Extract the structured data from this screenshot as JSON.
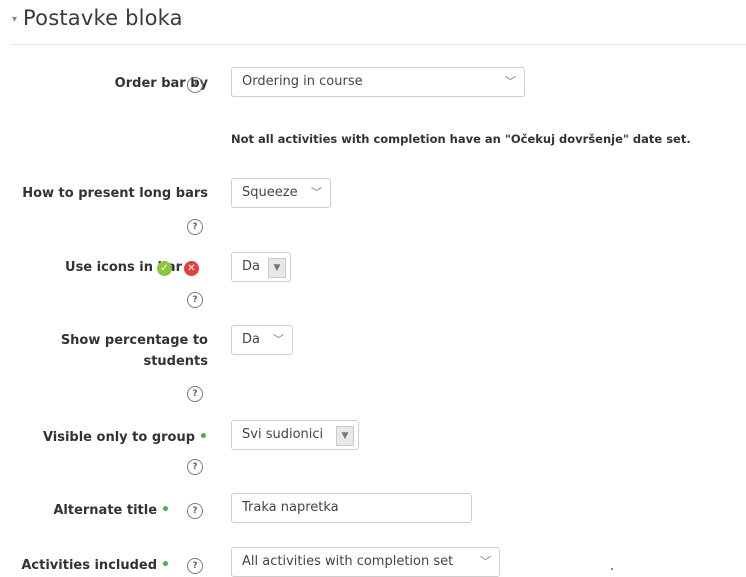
{
  "section": {
    "caret": "▾",
    "title": "Postavke bloka"
  },
  "help_glyph": "?",
  "advanced_marker": "•",
  "icons": {
    "ok": "✓",
    "no": "✕",
    "chevron": "﹀",
    "boxed_chevron": "▼"
  },
  "colors": {
    "advanced": "#4caf50",
    "ok_icon": "#8cc63f",
    "no_icon": "#e0413b"
  },
  "fields": {
    "order_bar_by": {
      "label": "Order bar by",
      "value": "Ordering in course"
    },
    "note": "Not all activities with completion have an \"Očekuj dovršenje\" date set.",
    "long_bars": {
      "label": "How to present long bars",
      "value": "Squeeze"
    },
    "use_icons": {
      "label": "Use icons in bar",
      "value": "Da"
    },
    "show_percentage": {
      "label_line1": "Show percentage to",
      "label_line2": "students",
      "value": "Da"
    },
    "visible_group": {
      "label": "Visible only to group",
      "value": "Svi sudionici"
    },
    "alternate_title": {
      "label": "Alternate title",
      "value": "Traka napretka"
    },
    "activities_included": {
      "label": "Activities included",
      "value": "All activities with completion set"
    }
  }
}
